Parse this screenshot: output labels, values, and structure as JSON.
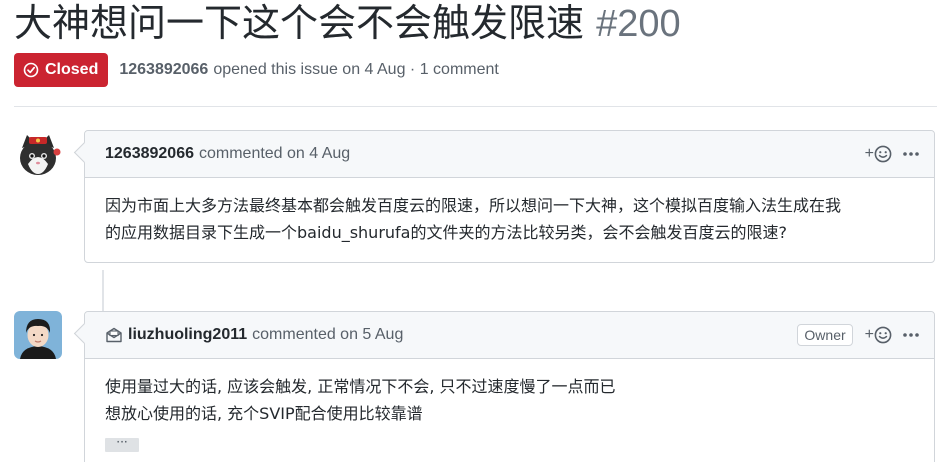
{
  "issue": {
    "title": "大神想问一下这个会不会触发限速",
    "number": "#200",
    "state": "Closed",
    "author": "1263892066",
    "opened_text": "opened this issue on 4 Aug · 1 comment"
  },
  "comments": [
    {
      "author": "1263892066",
      "meta": "commented on 4 Aug",
      "body": [
        "因为市面上大多方法最终基本都会触发百度云的限速，所以想问一下大神，这个模拟百度输入法生成在我",
        "的应用数据目录下生成一个baidu_shurufa的文件夹的方法比较另类，会不会触发百度云的限速?"
      ]
    },
    {
      "author": "liuzhuoling2011",
      "meta": "commented on 5 Aug",
      "badge": "Owner",
      "body": [
        "使用量过大的话, 应该会触发, 正常情况下不会, 只不过速度慢了一点而已",
        "想放心使用的话, 充个SVIP配合使用比较靠谱"
      ],
      "ellipsis": "···"
    }
  ],
  "actions": {
    "add_reaction": "+"
  },
  "colors": {
    "closed": "#cb2431",
    "header_bg": "#f6f8fa",
    "border": "#d1d5da"
  }
}
